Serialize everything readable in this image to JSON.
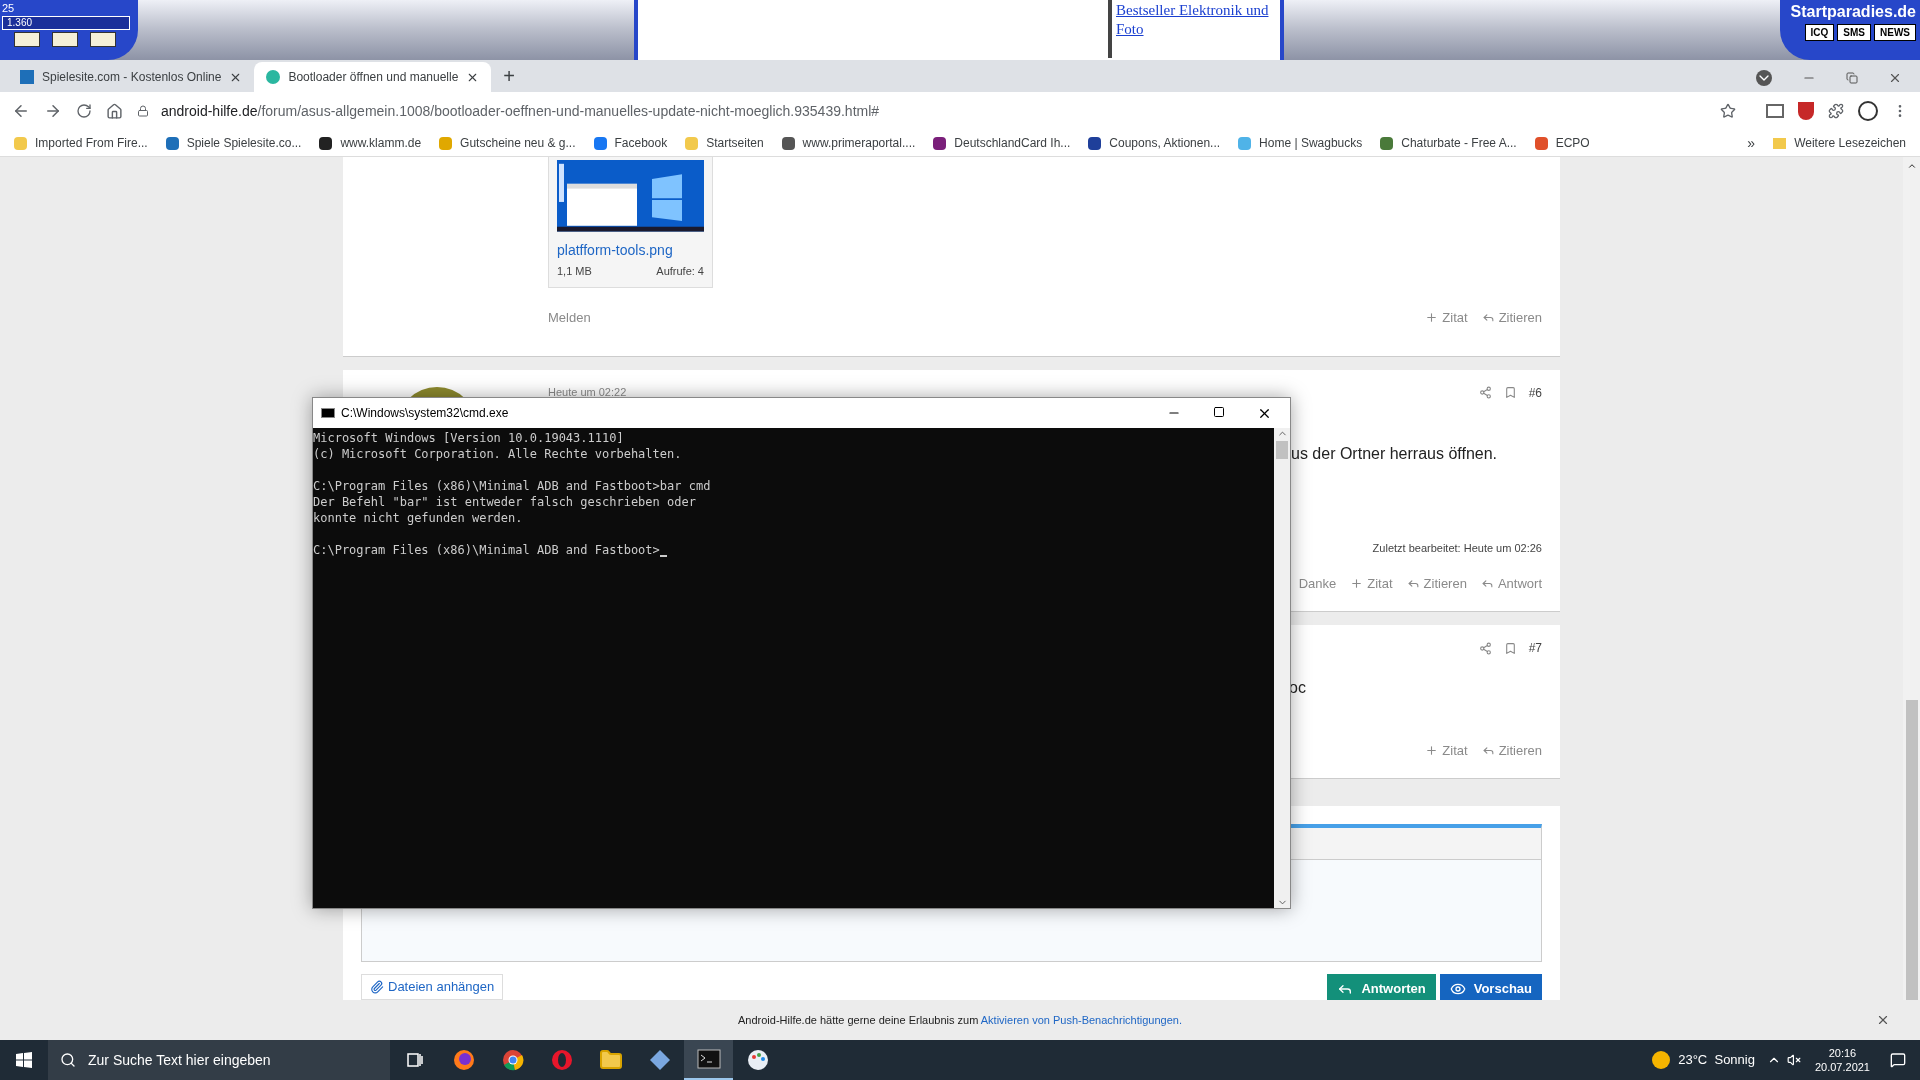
{
  "ad_banner": {
    "counter": "25",
    "score": "1.360",
    "link": "Bestseller Elektronik und Foto",
    "brand": "Startparadies.de",
    "buttons": [
      "ICQ",
      "SMS",
      "NEWS"
    ]
  },
  "tabs": [
    {
      "title": "Spielesite.com - Kostenlos Online",
      "selected": false
    },
    {
      "title": "Bootloader öffnen und manuelle",
      "selected": true
    }
  ],
  "new_tab": "+",
  "address": {
    "host": "android-hilfe.de",
    "path": "/forum/asus-allgemein.1008/bootloader-oeffnen-und-manuelles-update-nicht-moeglich.935439.html#"
  },
  "bookmarks": [
    {
      "label": "Imported From Fire...",
      "color": "#f2c94c"
    },
    {
      "label": "Spiele Spielesite.co...",
      "color": "#1e6fb8"
    },
    {
      "label": "www.klamm.de",
      "color": "#222222"
    },
    {
      "label": "Gutscheine neu & g...",
      "color": "#e0a800"
    },
    {
      "label": "Facebook",
      "color": "#1877f2"
    },
    {
      "label": "Startseiten",
      "color": "#f2c94c"
    },
    {
      "label": "www.primeraportal....",
      "color": "#555555"
    },
    {
      "label": "DeutschlandCard Ih...",
      "color": "#7a1f7a"
    },
    {
      "label": "Coupons, Aktionen...",
      "color": "#1f3f9a"
    },
    {
      "label": "Home | Swagbucks",
      "color": "#4fb3e8"
    },
    {
      "label": "Chaturbate - Free A...",
      "color": "#4a7a3a"
    },
    {
      "label": "ECPO",
      "color": "#e0502a"
    }
  ],
  "more_bookmarks": "»",
  "other_bookmarks": "Weitere Lesezeichen",
  "post_5": {
    "attachment": {
      "name": "platfform-tools.png",
      "size": "1,1 MB",
      "views": "Aufrufe: 4"
    },
    "report": "Melden",
    "actions": [
      {
        "kind": "plus",
        "label": "Zitat"
      },
      {
        "kind": "reply",
        "label": "Zitieren"
      }
    ]
  },
  "post_6": {
    "time": "Heute um 02:22",
    "number": "#6",
    "text": "us der Ortner herraus öffnen.",
    "edited": "Zuletzt bearbeitet: Heute um 02:26",
    "actions": [
      {
        "kind": "none",
        "label": "Danke"
      },
      {
        "kind": "plus",
        "label": "Zitat"
      },
      {
        "kind": "reply",
        "label": "Zitieren"
      },
      {
        "kind": "reply",
        "label": "Antwort"
      }
    ]
  },
  "post_7": {
    "number": "#7",
    "text": "oc",
    "actions": [
      {
        "kind": "plus",
        "label": "Zitat"
      },
      {
        "kind": "reply",
        "label": "Zitieren"
      }
    ]
  },
  "reply_form": {
    "attach": "Dateien anhängen",
    "submit": "Antworten",
    "preview": "Vorschau"
  },
  "notification": {
    "text": "Android-Hilfe.de hätte gerne deine Erlaubnis zum ",
    "link": "Aktivieren von Push-Benachrichtigungen."
  },
  "console": {
    "title": "C:\\Windows\\system32\\cmd.exe",
    "paragraphs": [
      [
        "Microsoft Windows [Version 10.0.19043.1110]",
        "(c) Microsoft Corporation. Alle Rechte vorbehalten."
      ],
      [
        "C:\\Program Files (x86)\\Minimal ADB and Fastboot>bar cmd",
        "Der Befehl \"bar\" ist entweder falsch geschrieben oder",
        "konnte nicht gefunden werden."
      ],
      [
        "C:\\Program Files (x86)\\Minimal ADB and Fastboot>"
      ]
    ]
  },
  "taskbar": {
    "search_placeholder": "Zur Suche Text hier eingeben",
    "apps": [
      {
        "kind": "taskview",
        "selected": false
      },
      {
        "kind": "firefox",
        "selected": false
      },
      {
        "kind": "chrome",
        "selected": false
      },
      {
        "kind": "opera",
        "selected": false
      },
      {
        "kind": "folder",
        "selected": false
      },
      {
        "kind": "diamond",
        "selected": false
      },
      {
        "kind": "terminal",
        "selected": true
      },
      {
        "kind": "paint",
        "selected": false
      }
    ],
    "weather": "23°C  Sonnig",
    "time": "20:16",
    "date": "20.07.2021"
  }
}
